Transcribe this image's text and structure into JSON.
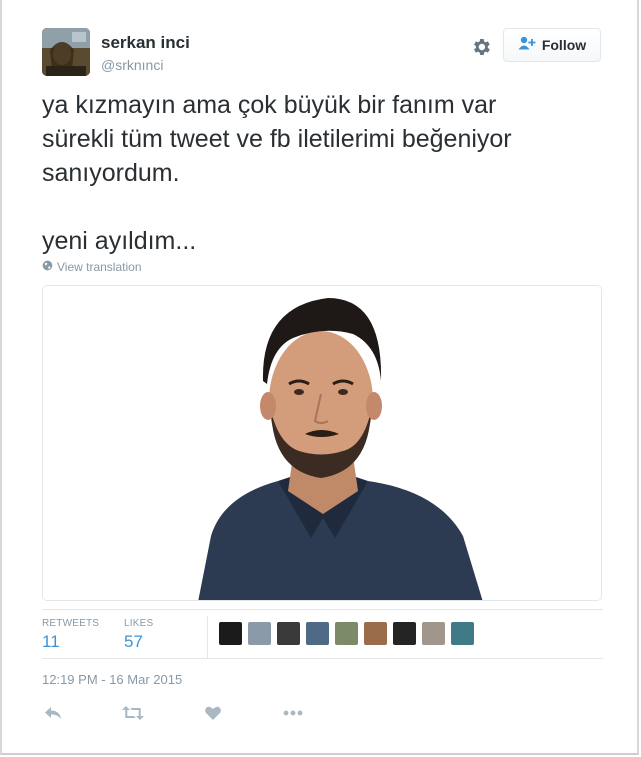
{
  "user": {
    "name": "serkan inci",
    "handle": "@srknınci",
    "follow_label": "Follow"
  },
  "tweet": {
    "text": "ya kızmayın ama çok büyük bir fanım var\nsürekli tüm tweet ve fb iletilerimi beğeniyor\nsanıyordum.\n\nyeni ayıldım...",
    "translate_label": "View translation"
  },
  "stats": {
    "retweets_label": "RETWEETS",
    "retweets_value": "11",
    "likes_label": "LIKES",
    "likes_value": "57"
  },
  "timestamp": "12:19 PM - 16 Mar 2015",
  "icons": {
    "settings": "gear-icon",
    "follow": "person-plus-icon",
    "translate": "globe-icon",
    "reply": "reply-icon",
    "retweet": "retweet-icon",
    "like": "heart-icon",
    "more": "more-icon"
  },
  "colors": {
    "accent": "#3b94d9",
    "muted": "#8899a6",
    "text": "#292f33",
    "border": "#e1e8ed"
  }
}
